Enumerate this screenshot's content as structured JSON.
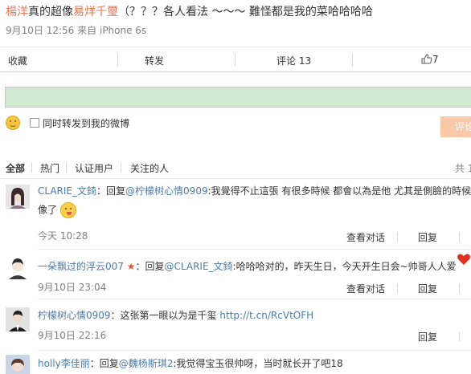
{
  "post": {
    "name1": "楊洋",
    "text1": "真的超像",
    "name2": "易烊千璽",
    "text2": "（？？？各人看法 ～～～ 難怪都是我的菜哈哈哈哈",
    "date": "9月10日 12:56",
    "source_prefix": "来自",
    "source": "iPhone 6s"
  },
  "actions": {
    "collect": "收藏",
    "repost": "转发",
    "comment": "评论 13",
    "like_count": "7"
  },
  "composer": {
    "repost_label": "同时转发到我的微博",
    "submit": "评论"
  },
  "filters": {
    "all": "全部",
    "hot": "热门",
    "verified": "认证用户",
    "following": "关注的人",
    "total": "共 1"
  },
  "comments": [
    {
      "user": "CLARIE_文錡",
      "sep": "：",
      "reply_prefix": "回复",
      "reply_to": "@柠檬树心情0909",
      "text": ":我覺得不止這張 有很多時候 都會以為是他 尤其是側臉的時候",
      "text2": "像了",
      "time": "今天 10:28",
      "view": "查看对话",
      "reply": "回复"
    },
    {
      "user": "一朵飘过的浮云007",
      "sep": "：回复",
      "reply_to": "@CLARIE_文錡",
      "text": ":哈哈哈对的，昨天生日，今天开生日会~帅哥人人爱",
      "time": "9月10日 23:04",
      "view": "查看对话",
      "reply": "回复"
    },
    {
      "user": "柠檬树心情0909",
      "text": "：这张第一眼以为是千玺",
      "link": "http://t.cn/RcVtOFH",
      "time": "9月10日 22:16",
      "reply": "回复"
    },
    {
      "user": "holly李佳丽",
      "sep": "：回复",
      "reply_to": "@魏杨斯琪2",
      "text": ":我觉得宝玉很帅呀，当时就长开了吧18"
    }
  ],
  "colors": {
    "highlight": "#eb7350",
    "link": "#4e7ba5",
    "input_bg": "#cde9cf",
    "submit_bg": "#f9c8a9"
  }
}
